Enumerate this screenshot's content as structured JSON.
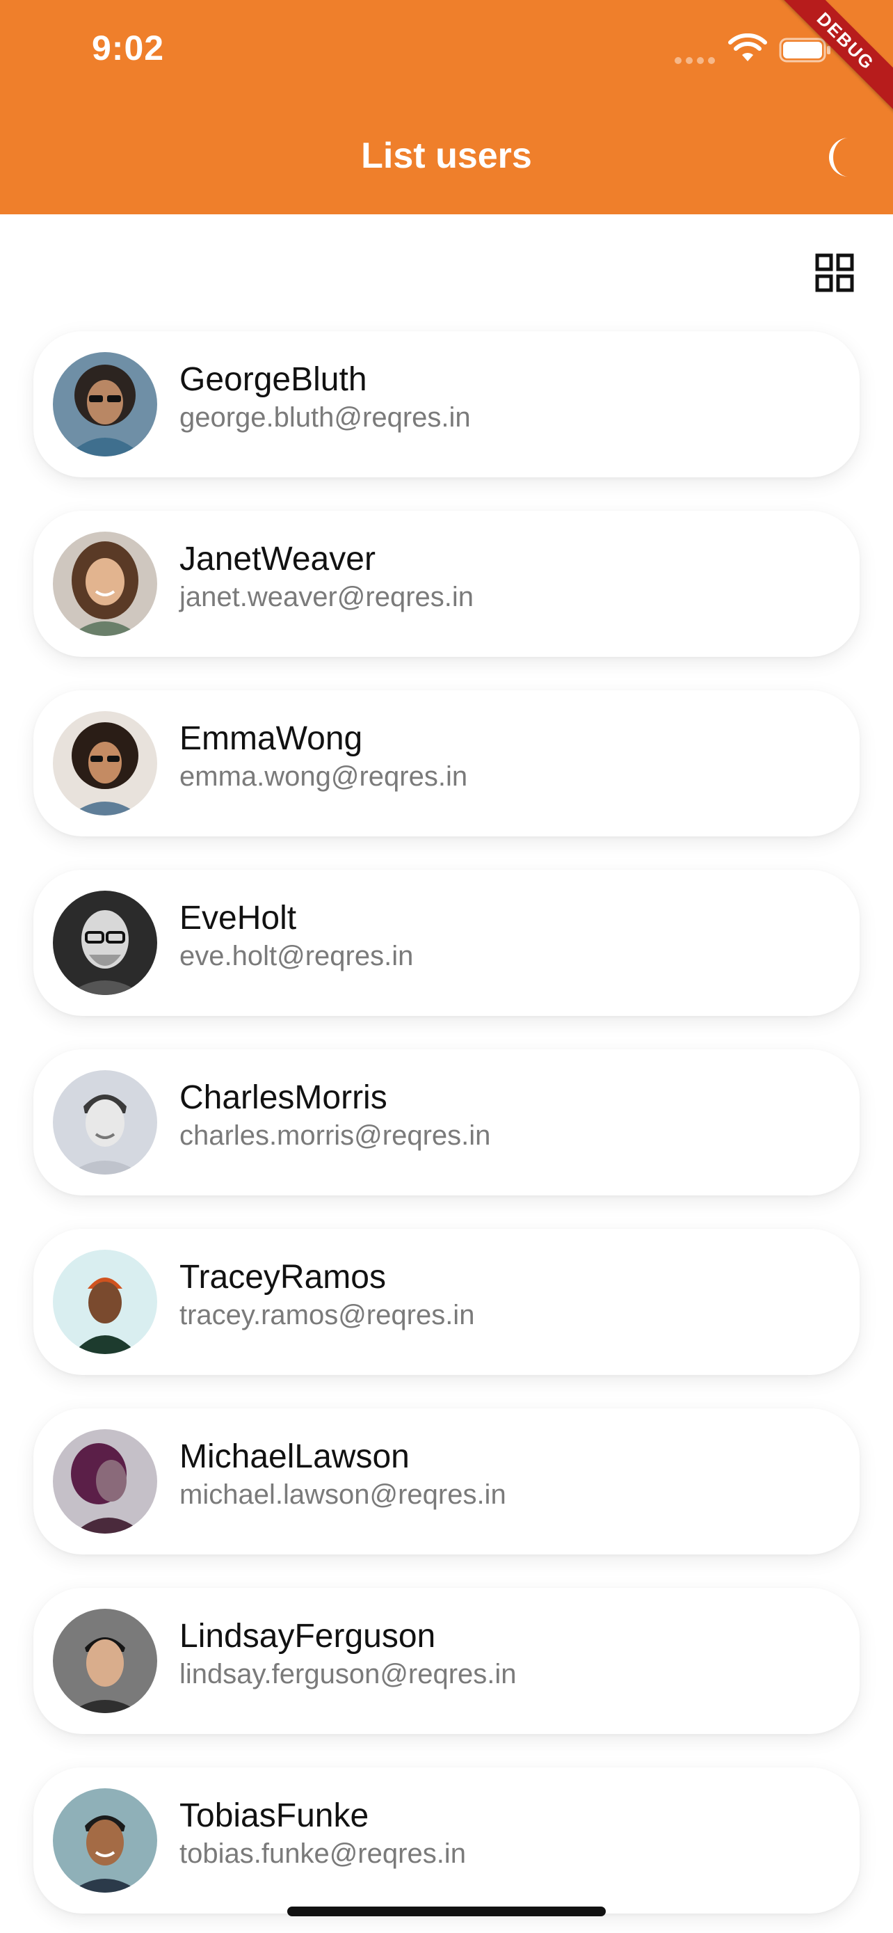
{
  "status_bar": {
    "time": "9:02"
  },
  "debug_banner": "DEBUG",
  "appbar": {
    "title": "List users",
    "theme_toggle_icon": "moon-icon",
    "background_color": "#ef7f2b"
  },
  "toolbar": {
    "layout_toggle_icon": "grid-view-icon"
  },
  "users": [
    {
      "name": "GeorgeBluth",
      "email": "george.bluth@reqres.in"
    },
    {
      "name": "JanetWeaver",
      "email": "janet.weaver@reqres.in"
    },
    {
      "name": "EmmaWong",
      "email": "emma.wong@reqres.in"
    },
    {
      "name": "EveHolt",
      "email": "eve.holt@reqres.in"
    },
    {
      "name": "CharlesMorris",
      "email": "charles.morris@reqres.in"
    },
    {
      "name": "TraceyRamos",
      "email": "tracey.ramos@reqres.in"
    },
    {
      "name": "MichaelLawson",
      "email": "michael.lawson@reqres.in"
    },
    {
      "name": "LindsayFerguson",
      "email": "lindsay.ferguson@reqres.in"
    },
    {
      "name": "TobiasFunke",
      "email": "tobias.funke@reqres.in"
    }
  ]
}
